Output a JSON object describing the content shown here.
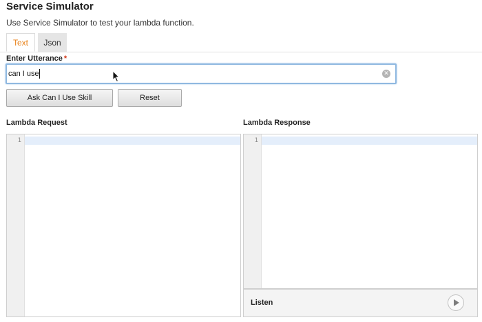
{
  "header": {
    "title": "Service Simulator",
    "subtitle": "Use Service Simulator to test your lambda function."
  },
  "tabs": [
    {
      "label": "Text",
      "active": true
    },
    {
      "label": "Json",
      "active": false
    }
  ],
  "utterance": {
    "label": "Enter Utterance",
    "required_mark": "*",
    "value": "can I use "
  },
  "buttons": {
    "ask_label": "Ask Can I Use Skill",
    "reset_label": "Reset"
  },
  "lambda_request": {
    "label": "Lambda Request",
    "line_numbers": [
      "1"
    ]
  },
  "lambda_response": {
    "label": "Lambda Response",
    "line_numbers": [
      "1"
    ]
  },
  "listen": {
    "label": "Listen"
  },
  "icons": {
    "clear": "clear-icon",
    "play": "play-icon",
    "cursor": "mouse-cursor-icon"
  },
  "colors": {
    "active_tab_text": "#e8821a",
    "focus_border": "#8fb8e0",
    "required": "#d13212"
  }
}
